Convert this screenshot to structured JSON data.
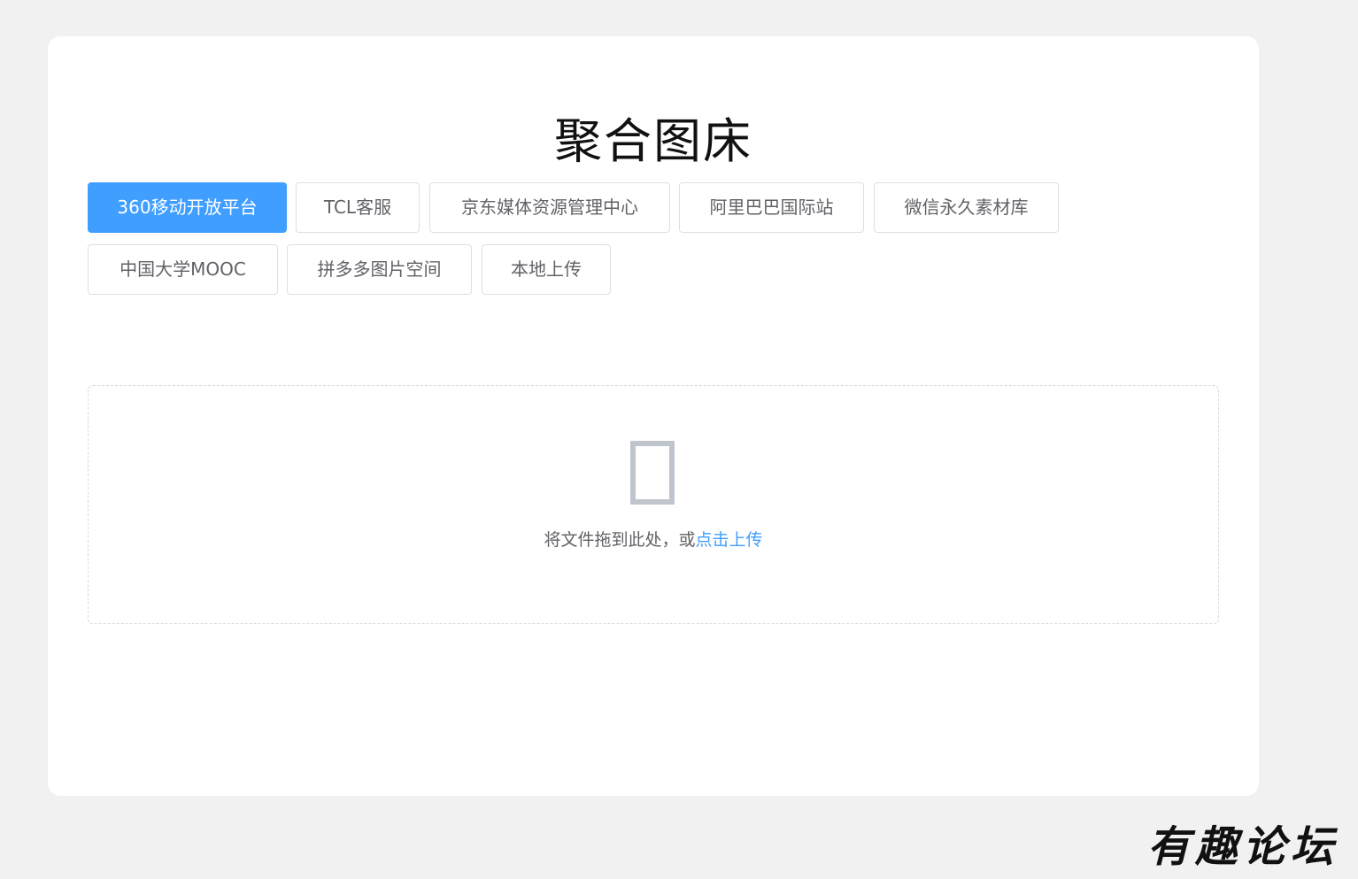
{
  "page": {
    "title": "聚合图床"
  },
  "tabs": [
    {
      "label": "360移动开放平台",
      "active": true
    },
    {
      "label": "TCL客服",
      "active": false
    },
    {
      "label": "京东媒体资源管理中心",
      "active": false
    },
    {
      "label": "阿里巴巴国际站",
      "active": false
    },
    {
      "label": "微信永久素材库",
      "active": false
    },
    {
      "label": "中国大学MOOC",
      "active": false
    },
    {
      "label": "拼多多图片空间",
      "active": false
    },
    {
      "label": "本地上传",
      "active": false
    }
  ],
  "upload": {
    "icon": "upload-icon",
    "prompt": "将文件拖到此处，或",
    "link": "点击上传"
  },
  "watermark": "有趣论坛",
  "colors": {
    "accent": "#409eff",
    "background": "#f1f1f1",
    "card": "#ffffff",
    "text": "#606266"
  }
}
